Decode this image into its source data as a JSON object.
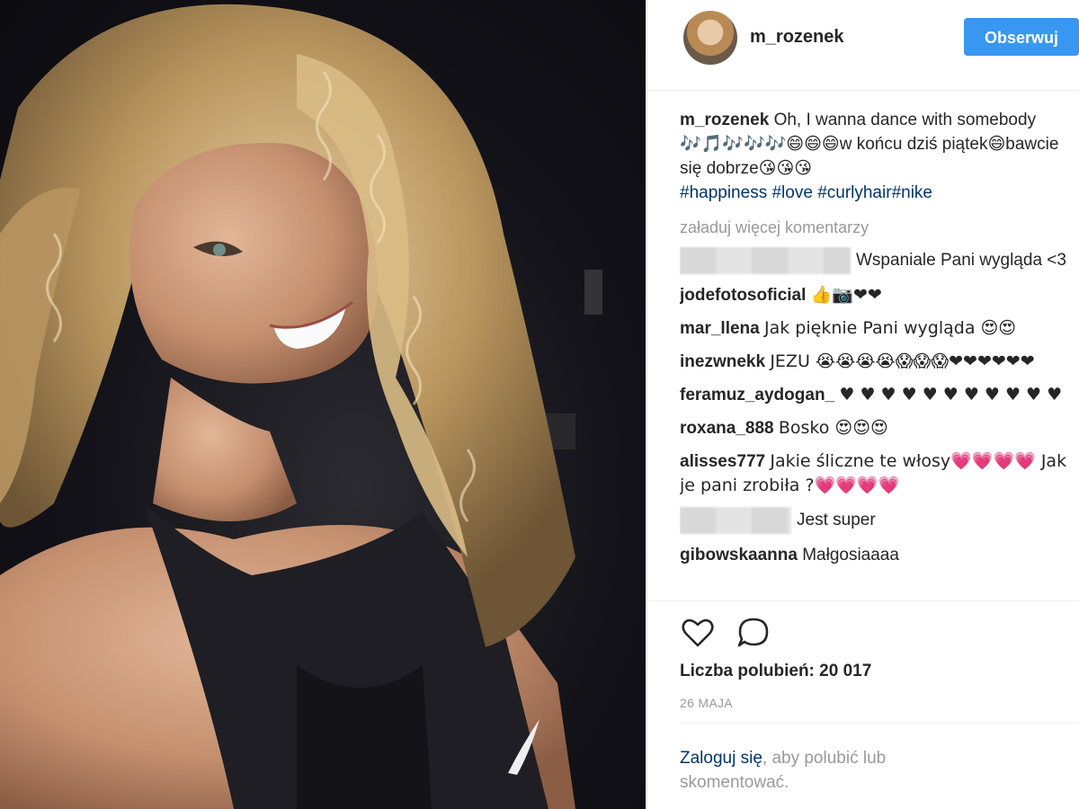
{
  "post": {
    "username": "m_rozenek",
    "follow_label": "Obserwuj"
  },
  "caption": {
    "username": "m_rozenek",
    "text_1": "Oh, I wanna dance with somebody ",
    "emoji_1": "🎶🎵🎶🎶🎶😄😄😄",
    "text_2": "w końcu dziś piątek",
    "emoji_2": "😄",
    "text_3": "bawcie się dobrze",
    "emoji_3": "😘😘😘",
    "hashtags": [
      "#happiness",
      "#love",
      "#curlyhair",
      "#nike"
    ]
  },
  "load_more_label": "załaduj więcej komentarzy",
  "comments": [
    {
      "username": "",
      "text": "Wspaniale Pani wygląda <3"
    },
    {
      "username": "jodefotosoficial",
      "text": "👍📷❤❤"
    },
    {
      "username": "mar_llena",
      "text": "Jak pięknie Pani wygląda 😍😍"
    },
    {
      "username": "inezwnekk",
      "text": "JEZU 😭😭😭😭😱😱😱❤❤❤❤❤❤"
    },
    {
      "username": "feramuz_aydogan_",
      "text": "♥ ♥ ♥ ♥ ♥ ♥ ♥ ♥ ♥ ♥ ♥"
    },
    {
      "username": "roxana_888",
      "text": "Bosko 😍😍😍"
    },
    {
      "username": "alisses777",
      "text": "Jakie śliczne te włosy💗💗💗💗 Jak je pani zrobiła ?💗💗💗💗"
    },
    {
      "username": "",
      "text": "Jest super"
    },
    {
      "username": "gibowskaanna",
      "text": "Małgosiaaaa"
    }
  ],
  "likes_label": "Liczba polubień: 20 017",
  "date_label": "26 MAJA",
  "login": {
    "link": "Zaloguj się",
    "rest": ", aby polubić lub skomentować."
  },
  "icons": {
    "like": "heart-icon",
    "comment": "comment-icon"
  },
  "colors": {
    "follow_button": "#3897f0",
    "hashtag": "#003569",
    "muted": "#999999"
  }
}
